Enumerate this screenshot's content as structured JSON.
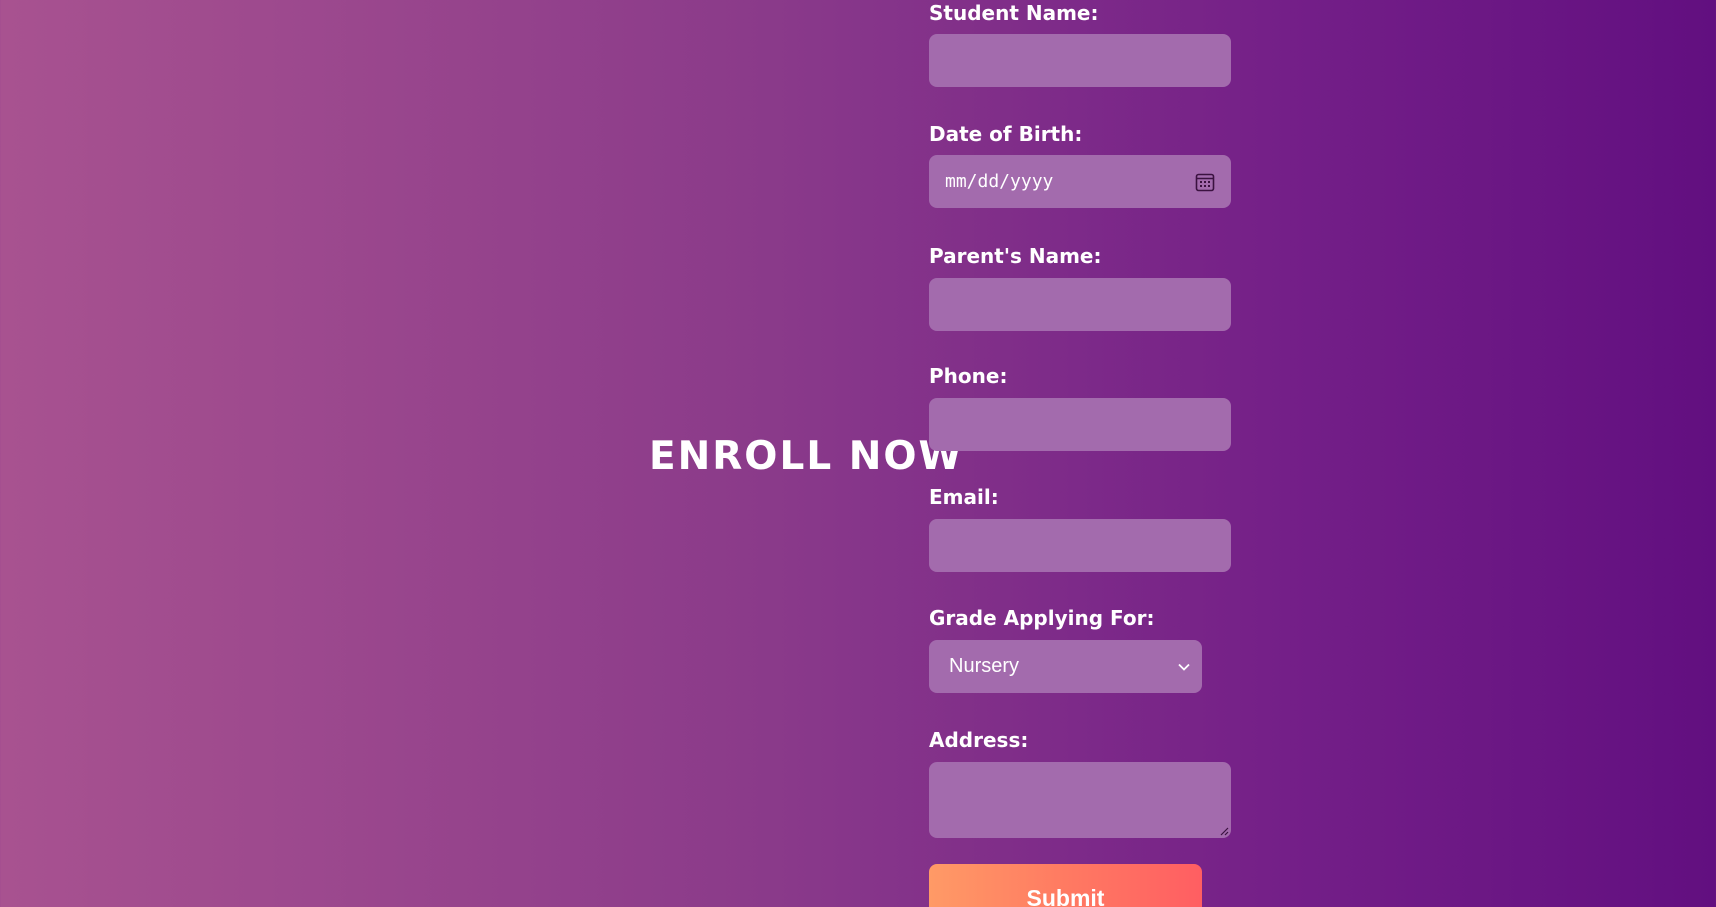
{
  "headline": "ENROLL NOW",
  "form": {
    "student_name": {
      "label": "Student Name:",
      "value": ""
    },
    "dob": {
      "label": "Date of Birth:",
      "placeholder": "mm/dd/yyyy",
      "icon": "calendar-icon"
    },
    "parent_name": {
      "label": "Parent's Name:",
      "value": ""
    },
    "phone": {
      "label": "Phone:",
      "value": ""
    },
    "email": {
      "label": "Email:",
      "value": ""
    },
    "grade": {
      "label": "Grade Applying For:",
      "selected": "Nursery",
      "icon": "chevron-down-icon"
    },
    "address": {
      "label": "Address:",
      "value": ""
    },
    "submit_label": "Submit"
  },
  "colors": {
    "background_left": "#a85290",
    "background_right": "#620f80",
    "field_bg": "#a36bad",
    "text": "#ffffff",
    "submit_start": "#ff9a66",
    "submit_end": "#ff5e62"
  }
}
